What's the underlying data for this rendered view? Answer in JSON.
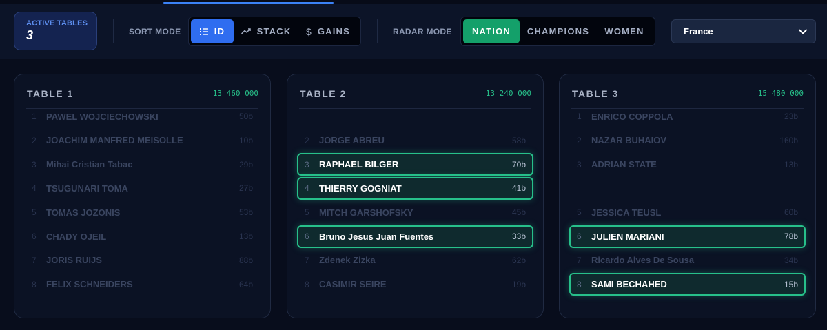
{
  "header": {
    "active_tables": {
      "label": "ACTIVE TABLES",
      "value": "3"
    },
    "sort_mode": {
      "label": "SORT MODE",
      "options": [
        {
          "label": "ID",
          "icon": "list-icon",
          "active": true
        },
        {
          "label": "STACK",
          "icon": "trend-icon",
          "active": false
        },
        {
          "label": "GAINS",
          "icon": "dollar-icon",
          "active": false
        }
      ]
    },
    "radar_mode": {
      "label": "RADAR MODE",
      "options": [
        {
          "label": "NATION",
          "active": true
        },
        {
          "label": "CHAMPIONS",
          "active": false
        },
        {
          "label": "WOMEN",
          "active": false
        }
      ]
    },
    "country": {
      "selected": "France"
    }
  },
  "colors": {
    "accent_blue": "#2f6df0",
    "accent_green": "#14a06a",
    "highlight_border": "#27c08a"
  },
  "tables": [
    {
      "title": "TABLE 1",
      "total": "13 460 000",
      "players": [
        {
          "seat": "1",
          "name": "PAWEL WOJCIECHOWSKI",
          "stack": "50b",
          "highlighted": false
        },
        {
          "seat": "2",
          "name": "JOACHIM MANFRED MEISOLLE",
          "stack": "10b",
          "highlighted": false
        },
        {
          "seat": "3",
          "name": "Mihai Cristian Tabac",
          "stack": "29b",
          "highlighted": false
        },
        {
          "seat": "4",
          "name": "TSUGUNARI TOMA",
          "stack": "27b",
          "highlighted": false
        },
        {
          "seat": "5",
          "name": "TOMAS JOZONIS",
          "stack": "53b",
          "highlighted": false
        },
        {
          "seat": "6",
          "name": "CHADY OJEIL",
          "stack": "13b",
          "highlighted": false
        },
        {
          "seat": "7",
          "name": "JORIS RUIJS",
          "stack": "88b",
          "highlighted": false
        },
        {
          "seat": "8",
          "name": "FELIX SCHNEIDERS",
          "stack": "64b",
          "highlighted": false
        }
      ]
    },
    {
      "title": "TABLE 2",
      "total": "13 240 000",
      "players": [
        {
          "seat": "2",
          "name": "JORGE ABREU",
          "stack": "58b",
          "highlighted": false
        },
        {
          "seat": "3",
          "name": "RAPHAEL BILGER",
          "stack": "70b",
          "highlighted": true
        },
        {
          "seat": "4",
          "name": "THIERRY GOGNIAT",
          "stack": "41b",
          "highlighted": true
        },
        {
          "seat": "5",
          "name": "MITCH GARSHOFSKY",
          "stack": "45b",
          "highlighted": false
        },
        {
          "seat": "6",
          "name": "Bruno Jesus Juan Fuentes",
          "stack": "33b",
          "highlighted": true
        },
        {
          "seat": "7",
          "name": "Zdenek Zizka",
          "stack": "62b",
          "highlighted": false
        },
        {
          "seat": "8",
          "name": "CASIMIR SEIRE",
          "stack": "19b",
          "highlighted": false
        }
      ]
    },
    {
      "title": "TABLE 3",
      "total": "15 480 000",
      "players": [
        {
          "seat": "1",
          "name": "ENRICO COPPOLA",
          "stack": "23b",
          "highlighted": false
        },
        {
          "seat": "2",
          "name": "NAZAR BUHAIOV",
          "stack": "160b",
          "highlighted": false
        },
        {
          "seat": "3",
          "name": "ADRIAN STATE",
          "stack": "13b",
          "highlighted": false
        },
        {
          "seat": "5",
          "name": "JESSICA TEUSL",
          "stack": "60b",
          "highlighted": false
        },
        {
          "seat": "6",
          "name": "JULIEN MARIANI",
          "stack": "78b",
          "highlighted": true
        },
        {
          "seat": "7",
          "name": "Ricardo Alves De Sousa",
          "stack": "34b",
          "highlighted": false
        },
        {
          "seat": "8",
          "name": "SAMI BECHAHED",
          "stack": "15b",
          "highlighted": true
        }
      ]
    }
  ]
}
